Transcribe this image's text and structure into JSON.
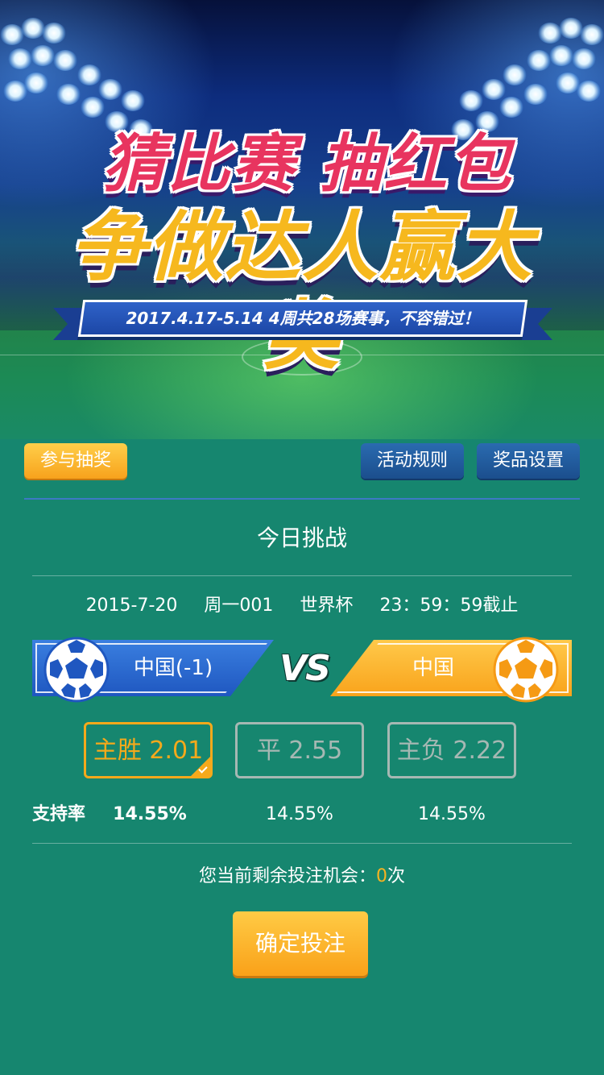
{
  "banner": {
    "title_line1": "猜比赛 抽红包",
    "title_line2": "争做达人赢大奖",
    "ribbon_text": "2017.4.17-5.14  4周共28场赛事，不容错过！"
  },
  "actions": {
    "join_lottery": "参与抽奖",
    "rules": "活动规则",
    "prize_settings": "奖品设置"
  },
  "challenge": {
    "title": "今日挑战",
    "date": "2015-7-20",
    "match_no": "周一001",
    "league": "世界杯",
    "deadline": "23：59：59截止"
  },
  "teams": {
    "home": "中国(-1)",
    "vs": "VS",
    "away": "中国"
  },
  "odds": {
    "win": "主胜 2.01",
    "draw": "平 2.55",
    "lose": "主负 2.22",
    "selected": "win"
  },
  "support": {
    "label": "支持率",
    "win": "14.55%",
    "draw": "14.55%",
    "lose": "14.55%"
  },
  "chance": {
    "prefix": "您当前剩余投注机会：",
    "count": "0",
    "suffix": "次"
  },
  "submit_label": "确定投注",
  "colors": {
    "background": "#16866f",
    "accent_orange": "#f5a91b",
    "accent_blue": "#1f57c0",
    "muted_border": "#a6b8b3"
  },
  "icons": [
    "soccer-ball-icon",
    "checkmark-icon"
  ]
}
